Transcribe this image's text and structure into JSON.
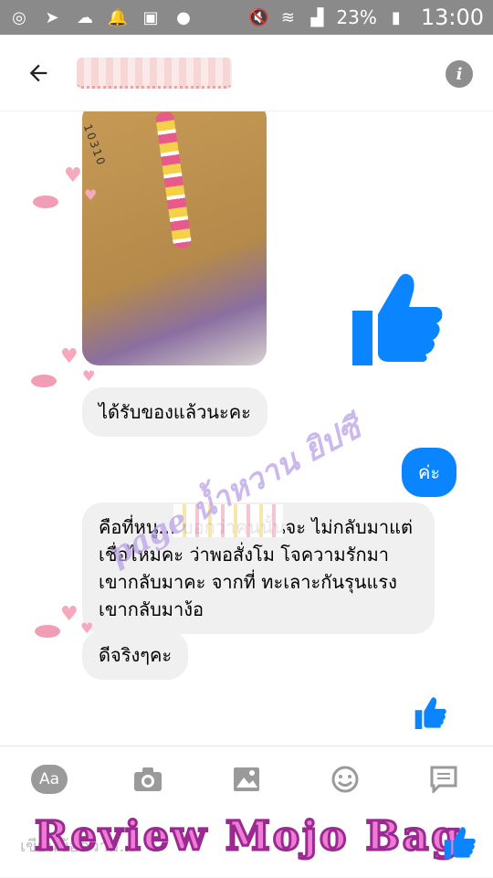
{
  "status_bar": {
    "battery": "23%",
    "time": "13:00"
  },
  "header": {
    "back_icon": "arrow-left-icon",
    "info_icon": "info-icon",
    "info_glyph": "i"
  },
  "photo": {
    "label_text": "10310"
  },
  "messages": [
    {
      "side": "them",
      "text": "ได้รับของแล้วนะคะ"
    },
    {
      "side": "me",
      "text": "ค่ะ"
    },
    {
      "side": "them",
      "text": "คือที่หนู... บอกว่าคนนั้นจะ ไม่กลับมาแต่เชื่อไหมคะ ว่าพอสั่งโม โจความรักมา เขากลับมาคะ จากที่ ทะเลาะกันรุนแรงเขากลับมาง้อ"
    },
    {
      "side": "them",
      "text": "ดีจริงๆคะ"
    }
  ],
  "watermark": "page น้ำหวาน ยิปซี",
  "composer": {
    "aa_label": "Aa",
    "placeholder": "เขียนข้อความ...",
    "overlay_text": "Review Mojo Bag"
  },
  "colors": {
    "accent": "#0a84ff",
    "statusbar": "#8a8a8a"
  }
}
